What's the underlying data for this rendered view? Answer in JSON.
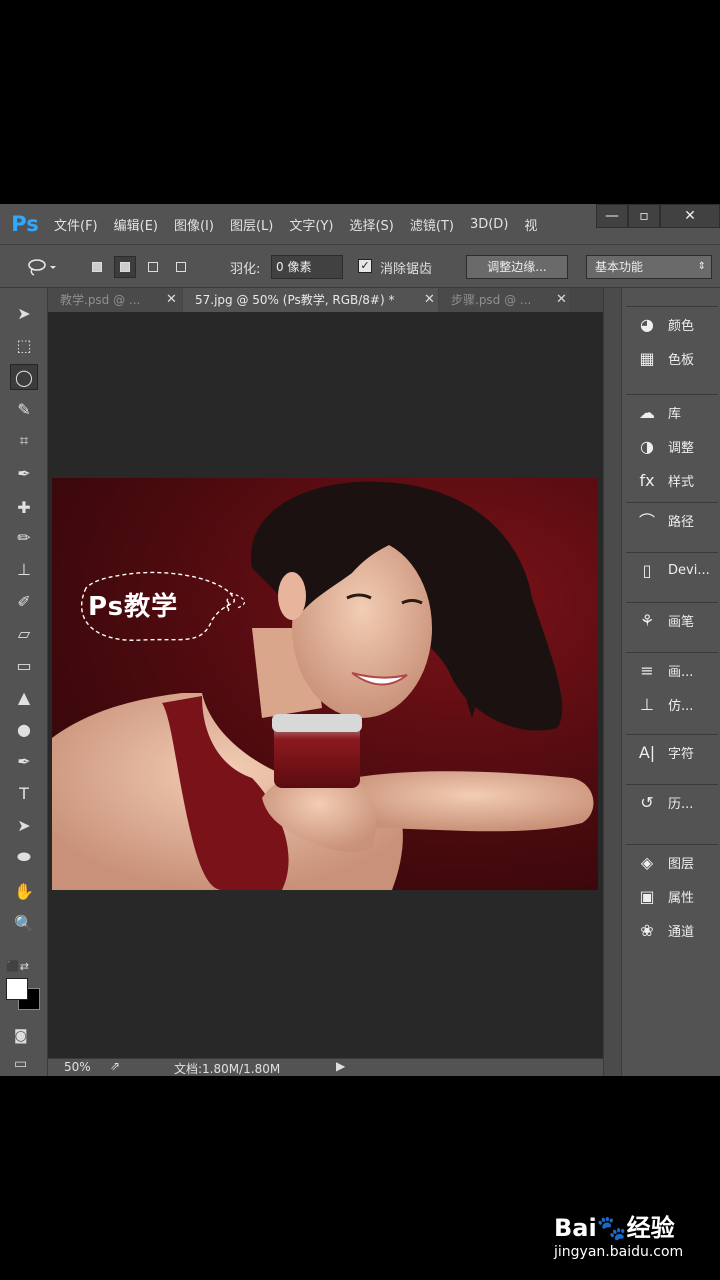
{
  "app": {
    "logo": "Ps",
    "menu": [
      "文件(F)",
      "编辑(E)",
      "图像(I)",
      "图层(L)",
      "文字(Y)",
      "选择(S)",
      "滤镜(T)",
      "3D(D)",
      "视"
    ],
    "window_controls": {
      "minimize": "—",
      "maximize": "▫",
      "close": "✕"
    }
  },
  "options": {
    "feather_label": "羽化:",
    "feather_value": "0 像素",
    "antialias_label": "消除锯齿",
    "antialias_checked": "✓",
    "refine_edge_label": "调整边缘...",
    "workspace_label": "基本功能"
  },
  "tabs": [
    {
      "label": "教学.psd @ ..."
    },
    {
      "label": "57.jpg @ 50% (Ps教学, RGB/8#) *"
    },
    {
      "label": "步骤.psd @ ..."
    }
  ],
  "tools": [
    {
      "name": "move-icon",
      "glyph": "➤"
    },
    {
      "name": "marquee-icon",
      "glyph": "⬚"
    },
    {
      "name": "lasso-icon",
      "glyph": "◯"
    },
    {
      "name": "quick-select-icon",
      "glyph": "✎"
    },
    {
      "name": "crop-icon",
      "glyph": "⌗"
    },
    {
      "name": "eyedropper-icon",
      "glyph": "✒"
    },
    {
      "name": "healing-icon",
      "glyph": "✚"
    },
    {
      "name": "brush-icon",
      "glyph": "✏"
    },
    {
      "name": "stamp-icon",
      "glyph": "⊥"
    },
    {
      "name": "history-brush-icon",
      "glyph": "✐"
    },
    {
      "name": "eraser-icon",
      "glyph": "▱"
    },
    {
      "name": "gradient-icon",
      "glyph": "▭"
    },
    {
      "name": "blur-icon",
      "glyph": "▲"
    },
    {
      "name": "dodge-icon",
      "glyph": "●"
    },
    {
      "name": "pen-icon",
      "glyph": "✒"
    },
    {
      "name": "type-icon",
      "glyph": "T"
    },
    {
      "name": "path-select-icon",
      "glyph": "➤"
    },
    {
      "name": "ellipse-icon",
      "glyph": "⬬"
    },
    {
      "name": "hand-icon",
      "glyph": "✋"
    },
    {
      "name": "zoom-icon",
      "glyph": "🔍"
    }
  ],
  "canvas": {
    "overlay_text": "Ps教学"
  },
  "status": {
    "zoom": "50%",
    "doc_size": "文档:1.80M/1.80M",
    "arrow": "▶"
  },
  "panels": [
    [
      {
        "label": "颜色",
        "icon": "palette-icon",
        "glyph": "◕"
      },
      {
        "label": "色板",
        "icon": "swatches-icon",
        "glyph": "▦"
      }
    ],
    [
      {
        "label": "库",
        "icon": "libraries-icon",
        "glyph": "☁"
      },
      {
        "label": "调整",
        "icon": "adjustments-icon",
        "glyph": "◑"
      },
      {
        "label": "样式",
        "icon": "styles-icon",
        "glyph": "fx"
      }
    ],
    [
      {
        "label": "路径",
        "icon": "paths-icon",
        "glyph": "⌒"
      }
    ],
    [
      {
        "label": "Devi...",
        "icon": "device-preview-icon",
        "glyph": "▯"
      }
    ],
    [
      {
        "label": "画笔",
        "icon": "brush-presets-icon",
        "glyph": "⚘"
      }
    ],
    [
      {
        "label": "画...",
        "icon": "brush-panel-icon",
        "glyph": "≡"
      },
      {
        "label": "仿...",
        "icon": "clone-source-icon",
        "glyph": "⊥"
      }
    ],
    [
      {
        "label": "字符",
        "icon": "character-icon",
        "glyph": "A|"
      }
    ],
    [
      {
        "label": "历...",
        "icon": "history-icon",
        "glyph": "↺"
      }
    ],
    [
      {
        "label": "图层",
        "icon": "layers-icon",
        "glyph": "◈"
      },
      {
        "label": "属性",
        "icon": "properties-icon",
        "glyph": "▣"
      },
      {
        "label": "通道",
        "icon": "channels-icon",
        "glyph": "❀"
      }
    ]
  ],
  "watermark": {
    "logo": "Bai🐾经验",
    "url": "jingyan.baidu.com"
  }
}
